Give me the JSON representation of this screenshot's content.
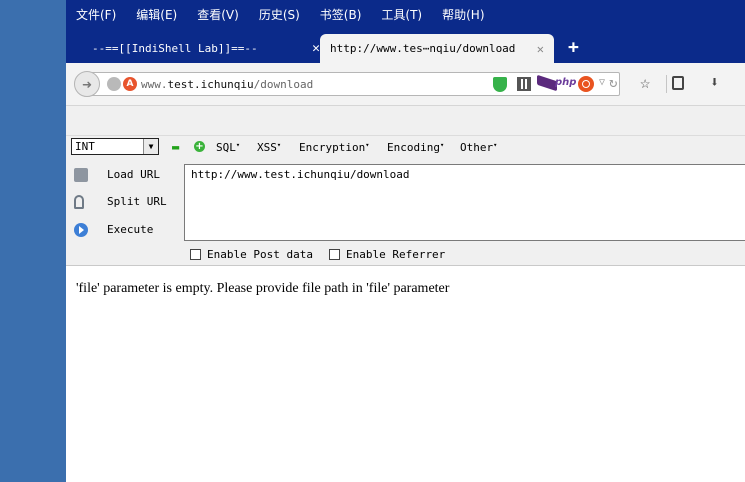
{
  "menubar": {
    "items": [
      "文件(F)",
      "编辑(E)",
      "查看(V)",
      "历史(S)",
      "书签(B)",
      "工具(T)",
      "帮助(H)"
    ]
  },
  "tabs": [
    {
      "title": "--==[[IndiShell Lab]]==--",
      "close": "✕",
      "active": false
    },
    {
      "title": "http://www.tes⋯nqiu/download",
      "close": "✕",
      "active": true
    }
  ],
  "new_tab": "+",
  "navbar": {
    "url_prefix": "www.",
    "url_host": "test.ichunqiu",
    "url_path": "/download",
    "php_icon_text": "php"
  },
  "hackbar": {
    "select_value": "INT",
    "menus": [
      "SQL",
      "XSS",
      "Encryption",
      "Encoding",
      "Other"
    ],
    "load_url": "Load URL",
    "split_url": "Split URL",
    "execute": "Execute",
    "url_value": "http://www.test.ichunqiu/download",
    "enable_post": "Enable Post data",
    "enable_referrer": "Enable Referrer"
  },
  "page": {
    "message": "'file' parameter is empty. Please provide file path in 'file' parameter"
  },
  "colors": {
    "menubar_bg": "#0b2a8a",
    "desktop": "#3b6fae"
  }
}
